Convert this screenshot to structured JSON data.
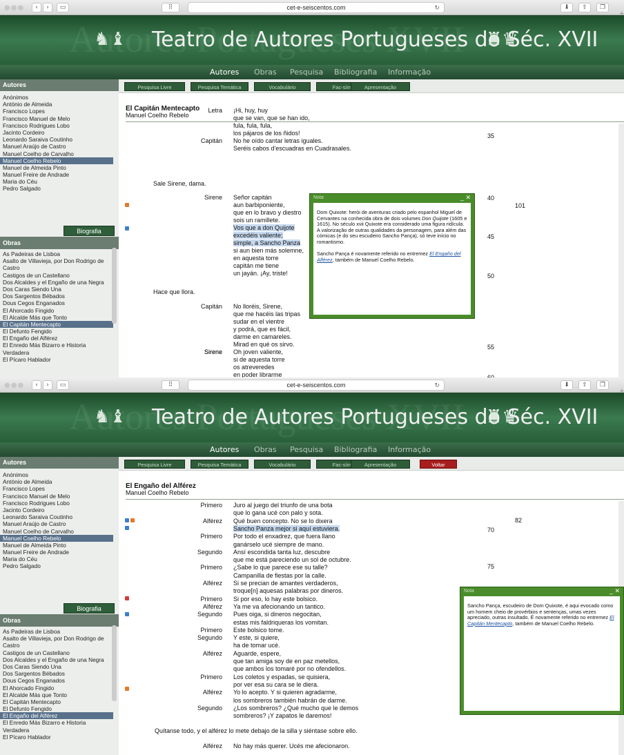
{
  "browser": {
    "url": "cet-e-seiscentos.com"
  },
  "site": {
    "title": "Teatro de Autores Portugueses do Séc. XVII",
    "ghost": "Autores Portugueses XVII"
  },
  "nav": [
    "Autores",
    "Obras",
    "Pesquisa",
    "Bibliografia",
    "Informação"
  ],
  "tools": {
    "pesquisa_livre": "Pesquisa Livre",
    "pesquisa_tematica": "Pesquisa Temática",
    "vocabulario": "Vocabulário",
    "fac_simile": "Fac-símile",
    "apresentacao": "Apresentação",
    "voltar": "Voltar"
  },
  "sidebar": {
    "autores_heading": "Autores",
    "obras_heading": "Obras",
    "biografia": "Biografia",
    "autores": [
      "Anónimos",
      "António de Almeida",
      "Francisco Lopes",
      "Francisco Manuel de Melo",
      "Francisco Rodrigues Lobo",
      "Jacinto Cordeiro",
      "Leonardo Saraiva Coutinho",
      "Manuel Araújo de Castro",
      "Manuel Coelho de Carvalho",
      "Manuel Coelho Rebelo",
      "Manuel de Almeida Pinto",
      "Manuel Freire de Andrade",
      "Maria do Céu",
      "Pedro Salgado"
    ],
    "obras": [
      "As Padeiras de Lisboa",
      "Asalto de Villavieja, por Don Rodrigo de",
      "Castro",
      "Castigos de un Castellano",
      "Dos Alcaldes y el Engaño de una Negra",
      "Dos Caras Siendo Una",
      "Dos Sargentos Bébados",
      "Dous Cegos Enganados",
      "El Ahorcado Fingido",
      "El Alcalde Más que Tonto",
      "El Capitán Mentecapto",
      "El Defunto Fengido",
      "El Engaño del Alférez",
      "El Enredo Más Bizarro e Historia",
      "Verdadera",
      "El Pícaro Hablador"
    ]
  },
  "w1": {
    "title": "El Capitán Mentecapto",
    "author": "Manuel Coelho Rebelo",
    "lines": [
      [
        "Letra",
        "¡Hi, huy, huy"
      ],
      [
        "",
        "que se van, que se han ido,"
      ],
      [
        "",
        "fula, fula, fula,"
      ],
      [
        "",
        "los pájaros de los ñidos!"
      ],
      [
        "Capitán",
        "No he oído cantar letras iguales."
      ],
      [
        "",
        "Seréis cabos d'escuadras en Cuadrasales."
      ],
      [
        "",
        "Señor capitán"
      ],
      [
        "",
        "aun barbiponiente,"
      ],
      [
        "",
        "que en lo bravo y diestro"
      ],
      [
        "",
        "sois un ramillete."
      ],
      [
        "",
        "Vos que a don Quijote"
      ],
      [
        "",
        "excedéis valiente;"
      ],
      [
        "",
        "simple, a Sancho Panza"
      ],
      [
        "",
        "si aun bien más solemne,"
      ],
      [
        "",
        "en aquesta torre"
      ],
      [
        "",
        "capitán me tiene"
      ],
      [
        "",
        "un jayán. ¡Ay, triste!"
      ],
      [
        "Capitán",
        "No lloréis, Sirene,"
      ],
      [
        "",
        "que me hacéis las tripas"
      ],
      [
        "",
        "sudar en el vientre"
      ],
      [
        "",
        "y podrá, que es fácil,"
      ],
      [
        "",
        "darme en camareles."
      ],
      [
        "",
        "Mirad en qué os sirvo."
      ],
      [
        "Sirene",
        "Oh joven valiente,"
      ],
      [
        "",
        "si de aquesta torre"
      ],
      [
        "",
        "os atreveredes"
      ],
      [
        "",
        "en poder librarme"
      ]
    ],
    "sirene": "Sirene",
    "stage1": "Sale Sirene, dama.",
    "stage2": "Hace que llora.",
    "nums": [
      "35",
      "40",
      "101",
      "45",
      "50",
      "55",
      "60"
    ],
    "note": {
      "header": "Nota",
      "p1a": "Dom Quixote: herói de aventuras criado pelo espanhol Miguel de Cervantes na conhecida obra de dois volumes ",
      "p1i": "Don Quijote",
      "p1b": " (1605 e 1615). No século xvii Quixote era considerado uma figura ridícula. A valorização de outras qualidades da personagem, para além das cómicas (e do seu escudeiro Sancho Pança), só teve início no romantismo.",
      "p2a": "Sancho Pança é novamente referido no entremez ",
      "link": "El Engaño del Alférez",
      "p2b": ", também de Manuel Coelho Rebelo."
    }
  },
  "w2": {
    "title": "El Engaño del Alférez",
    "author": "Manuel Coelho Rebelo",
    "lines": [
      [
        "Primero",
        "Juro al juego del triunfo de una bota"
      ],
      [
        "",
        "que lo gana ucé con palo y sota."
      ],
      [
        "Alférez",
        "Qué buen concepto. No se lo dixera"
      ],
      [
        "",
        "Sancho Panza mejor si aquí estuviera."
      ],
      [
        "Primero",
        "Por todo el enxadrez, que fuera llano"
      ],
      [
        "",
        "ganárselo ucé siempre de mano."
      ],
      [
        "Segundo",
        "Ansí escondida tanta luz, descubre"
      ],
      [
        "",
        "que me está pareciendo un sol de octubre."
      ],
      [
        "Primero",
        "¿Sabe lo que parece ese su talle?"
      ],
      [
        "",
        "Campanilla de fiestas por la calle."
      ],
      [
        "Alférez",
        "Si se precian de amantes verdaderos,"
      ],
      [
        "",
        "troque[n] aquesas palabras por dineros."
      ],
      [
        "Primero",
        "Si por eso, lo hay este bolsico."
      ],
      [
        "Alférez",
        "Ya me va afecionando un tantico."
      ],
      [
        "Segundo",
        "Pues oiga, si dineros negocitan,"
      ],
      [
        "",
        "estas mis faldriqueras los vomitan."
      ],
      [
        "Primero",
        "Este bolsico tome."
      ],
      [
        "Segundo",
        "                    Y este, si quiere,"
      ],
      [
        "",
        "ha de tomar ucé."
      ],
      [
        "Alférez",
        "                    Aguarde, espere,"
      ],
      [
        "",
        "que tan amiga soy de en paz metellos,"
      ],
      [
        "",
        "que ambos los tomaré por no ofendellos."
      ],
      [
        "Primero",
        "Los coletos y espadas, se quisiera,"
      ],
      [
        "",
        "por ver esa su cara se le diera."
      ],
      [
        "Alférez",
        "Yo lo acepto. Y si quieren agradarme,"
      ],
      [
        "",
        "los sombreros también habrán de darme."
      ],
      [
        "Segundo",
        "¿Los sombreros? ¿Qué mucho que le demos"
      ],
      [
        "",
        "sombreros? ¡Y zapatos le daremos!"
      ]
    ],
    "stage": "Quítanse todo, y el alférez lo mete debajo de la silla y siéntase sobre ello.",
    "last": [
      "Alférez",
      "No hay más querer. Ucés me afecionaron."
    ],
    "nums": [
      "82",
      "70",
      "75"
    ],
    "note": {
      "header": "Nota",
      "a": "Sancho Pança, escudeiro de Dom Quixote, é aqui evocado como um homem cheio de provérbios e sentenças, umas vezes apreciado, outras insultado. É novamente referido no entremez ",
      "link": "El Capitán Mentecapto",
      "b": ", também de Manuel Coelho Rebelo."
    }
  }
}
